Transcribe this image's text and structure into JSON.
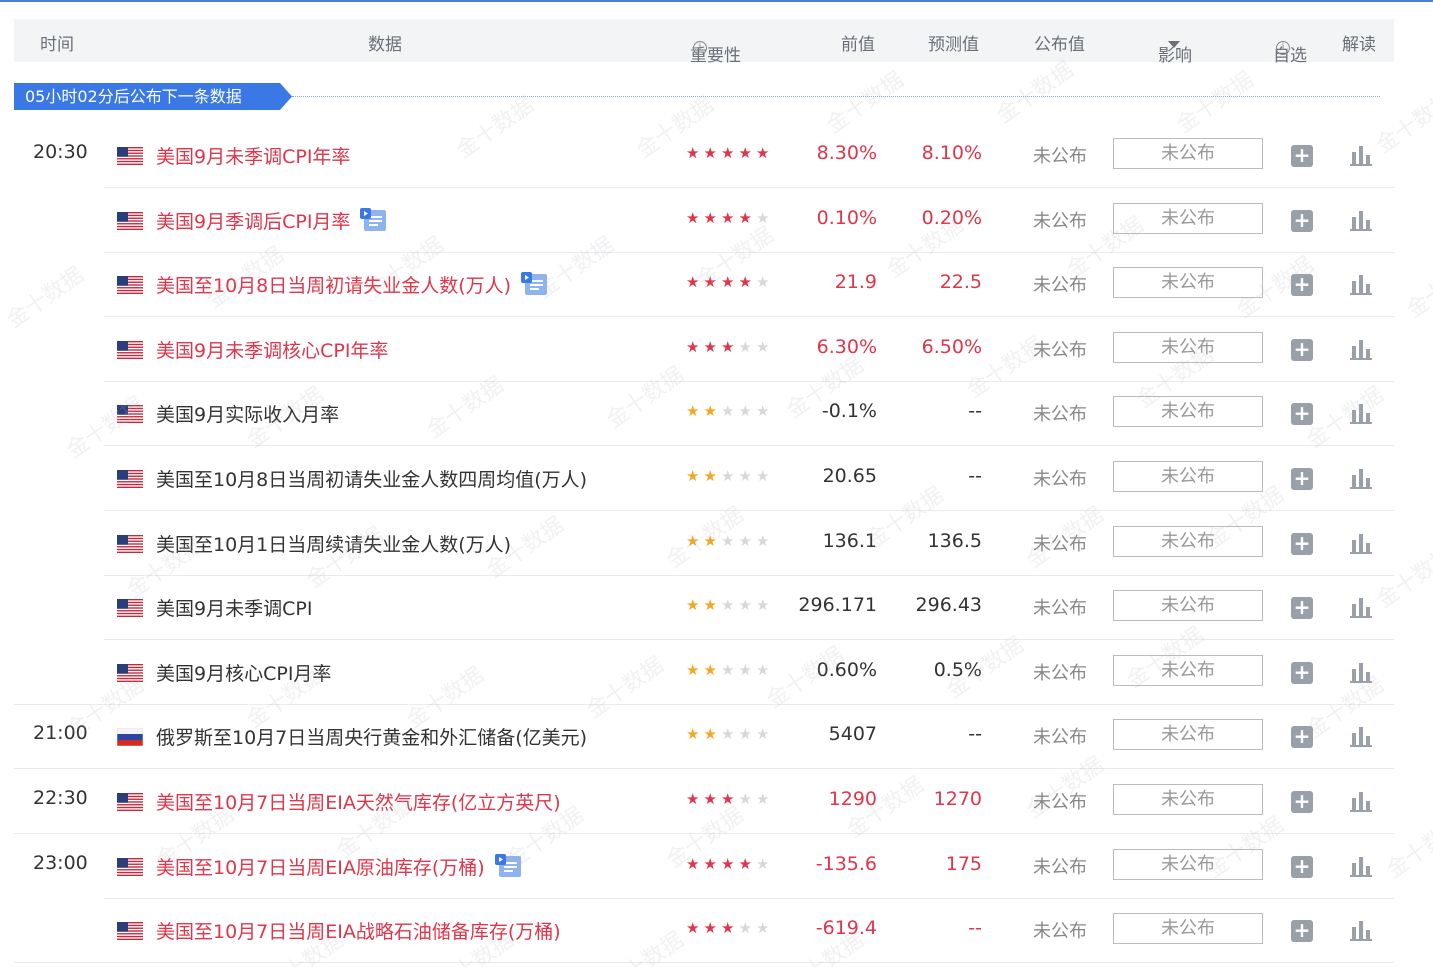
{
  "header": {
    "time": "时间",
    "data": "数据",
    "importance": "重要性",
    "previous": "前值",
    "forecast": "预测值",
    "published": "公布值",
    "impact": "影响",
    "favorite": "自选",
    "interpret": "解读"
  },
  "banner": "05小时02分后公布下一条数据",
  "watermark": "金十数据",
  "colors": {
    "accent": "#3a78e6",
    "red_text": "#e0354a",
    "star_red": "#e0354a",
    "star_gold": "#f5a623",
    "star_empty": "#d8d8d8"
  },
  "rows": [
    {
      "time": "20:30",
      "flag": "us",
      "name": "美国9月未季调CPI年率",
      "red": true,
      "doc": false,
      "stars": 5,
      "star_color": "red",
      "previous": "8.30%",
      "forecast": "8.10%",
      "prev_red": true,
      "fore_red": true,
      "published": "未公布",
      "impact": "未公布"
    },
    {
      "time": "",
      "flag": "us",
      "name": "美国9月季调后CPI月率",
      "red": true,
      "doc": true,
      "stars": 4,
      "star_color": "red",
      "previous": "0.10%",
      "forecast": "0.20%",
      "prev_red": true,
      "fore_red": true,
      "published": "未公布",
      "impact": "未公布"
    },
    {
      "time": "",
      "flag": "us",
      "name": "美国至10月8日当周初请失业金人数(万人)",
      "red": true,
      "doc": true,
      "stars": 4,
      "star_color": "red",
      "previous": "21.9",
      "forecast": "22.5",
      "prev_red": true,
      "fore_red": true,
      "published": "未公布",
      "impact": "未公布"
    },
    {
      "time": "",
      "flag": "us",
      "name": "美国9月未季调核心CPI年率",
      "red": true,
      "doc": false,
      "stars": 3,
      "star_color": "red",
      "previous": "6.30%",
      "forecast": "6.50%",
      "prev_red": true,
      "fore_red": true,
      "published": "未公布",
      "impact": "未公布"
    },
    {
      "time": "",
      "flag": "us",
      "name": "美国9月实际收入月率",
      "red": false,
      "doc": false,
      "stars": 2,
      "star_color": "gold",
      "previous": "-0.1%",
      "forecast": "--",
      "prev_red": false,
      "fore_red": false,
      "published": "未公布",
      "impact": "未公布"
    },
    {
      "time": "",
      "flag": "us",
      "name": "美国至10月8日当周初请失业金人数四周均值(万人)",
      "red": false,
      "doc": false,
      "stars": 2,
      "star_color": "gold",
      "previous": "20.65",
      "forecast": "--",
      "prev_red": false,
      "fore_red": false,
      "published": "未公布",
      "impact": "未公布"
    },
    {
      "time": "",
      "flag": "us",
      "name": "美国至10月1日当周续请失业金人数(万人)",
      "red": false,
      "doc": false,
      "stars": 2,
      "star_color": "gold",
      "previous": "136.1",
      "forecast": "136.5",
      "prev_red": false,
      "fore_red": false,
      "published": "未公布",
      "impact": "未公布"
    },
    {
      "time": "",
      "flag": "us",
      "name": "美国9月未季调CPI",
      "red": false,
      "doc": false,
      "stars": 2,
      "star_color": "gold",
      "previous": "296.171",
      "forecast": "296.43",
      "prev_red": false,
      "fore_red": false,
      "published": "未公布",
      "impact": "未公布"
    },
    {
      "time": "",
      "flag": "us",
      "name": "美国9月核心CPI月率",
      "red": false,
      "doc": false,
      "stars": 2,
      "star_color": "gold",
      "previous": "0.60%",
      "forecast": "0.5%",
      "prev_red": false,
      "fore_red": false,
      "published": "未公布",
      "impact": "未公布"
    },
    {
      "time": "21:00",
      "flag": "ru",
      "name": "俄罗斯至10月7日当周央行黄金和外汇储备(亿美元)",
      "red": false,
      "doc": false,
      "stars": 2,
      "star_color": "gold",
      "previous": "5407",
      "forecast": "--",
      "prev_red": false,
      "fore_red": false,
      "published": "未公布",
      "impact": "未公布"
    },
    {
      "time": "22:30",
      "flag": "us",
      "name": "美国至10月7日当周EIA天然气库存(亿立方英尺)",
      "red": true,
      "doc": false,
      "stars": 3,
      "star_color": "red",
      "previous": "1290",
      "forecast": "1270",
      "prev_red": true,
      "fore_red": true,
      "published": "未公布",
      "impact": "未公布"
    },
    {
      "time": "23:00",
      "flag": "us",
      "name": "美国至10月7日当周EIA原油库存(万桶)",
      "red": true,
      "doc": true,
      "stars": 4,
      "star_color": "red",
      "previous": "-135.6",
      "forecast": "175",
      "prev_red": true,
      "fore_red": true,
      "published": "未公布",
      "impact": "未公布"
    },
    {
      "time": "",
      "flag": "us",
      "name": "美国至10月7日当周EIA战略石油储备库存(万桶)",
      "red": true,
      "doc": false,
      "stars": 3,
      "star_color": "red",
      "previous": "-619.4",
      "forecast": "--",
      "prev_red": true,
      "fore_red": true,
      "published": "未公布",
      "impact": "未公布"
    }
  ]
}
